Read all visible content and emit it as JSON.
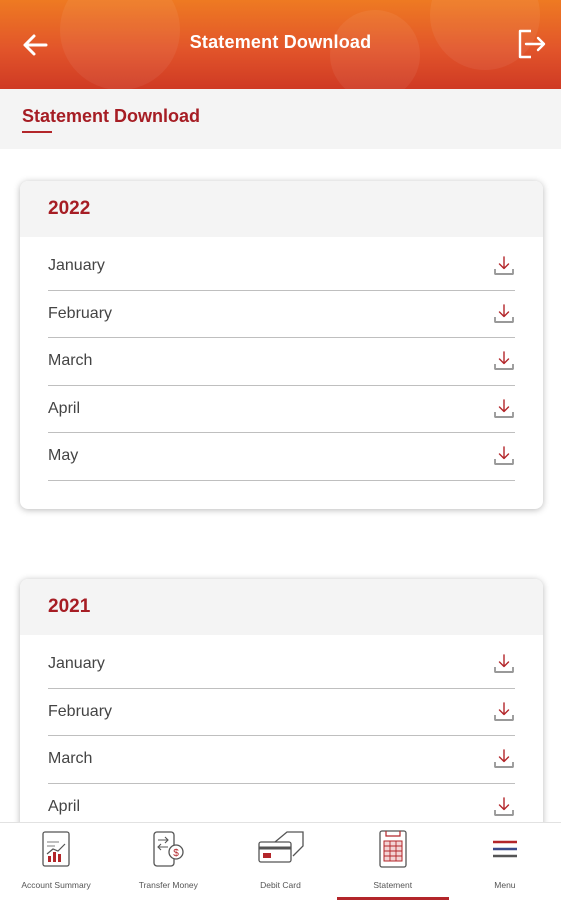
{
  "appbar": {
    "title": "Statement Download"
  },
  "subheader": {
    "title": "Statement Download"
  },
  "statements": [
    {
      "year": "2022",
      "months": [
        "January",
        "February",
        "March",
        "April",
        "May"
      ]
    },
    {
      "year": "2021",
      "months": [
        "January",
        "February",
        "March",
        "April"
      ]
    }
  ],
  "bottom_nav": [
    {
      "label": "Account Summary",
      "icon": "account-summary-icon"
    },
    {
      "label": "Transfer Money",
      "icon": "transfer-money-icon"
    },
    {
      "label": "Debit Card",
      "icon": "debit-card-icon"
    },
    {
      "label": "Statement",
      "icon": "statement-icon",
      "active": true
    },
    {
      "label": "Menu",
      "icon": "menu-icon"
    }
  ],
  "colors": {
    "accent": "#a61d24",
    "header_gradient_top": "#ee7a22",
    "header_gradient_bottom": "#cf3a24"
  }
}
